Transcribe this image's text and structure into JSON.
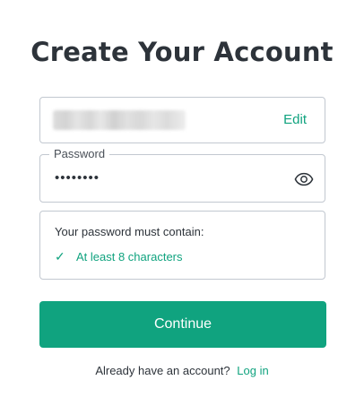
{
  "page": {
    "title": "Create Your Account"
  },
  "email_field": {
    "value_state": "redacted",
    "edit_label": "Edit"
  },
  "password_field": {
    "label": "Password",
    "masked_value": "••••••••",
    "toggle_icon": "eye-icon"
  },
  "password_rules": {
    "heading": "Your password must contain:",
    "items": [
      {
        "check_glyph": "✓",
        "text": "At least 8 characters",
        "satisfied": true
      }
    ]
  },
  "actions": {
    "continue_label": "Continue"
  },
  "footer": {
    "prompt": "Already have an account?",
    "login_label": "Log in"
  },
  "colors": {
    "accent": "#10a37f",
    "text": "#2d333a",
    "border": "#c2c8d0"
  }
}
